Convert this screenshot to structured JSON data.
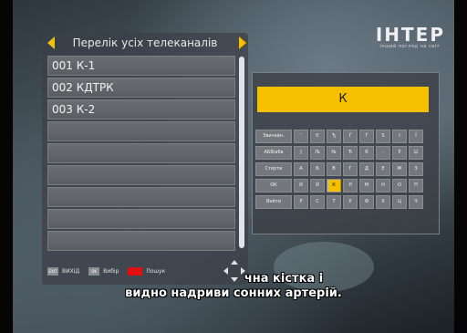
{
  "channel": {
    "logo": "ІНТЕР",
    "logo_tagline": "інший погляд на світ"
  },
  "panel": {
    "title": "Перелік усіх телеканалів",
    "items": [
      {
        "label": "001 К-1"
      },
      {
        "label": "002 КДТРК"
      },
      {
        "label": "003 К-2"
      },
      {
        "label": ""
      },
      {
        "label": ""
      },
      {
        "label": ""
      },
      {
        "label": ""
      },
      {
        "label": ""
      },
      {
        "label": ""
      }
    ]
  },
  "footer": {
    "exit_key": "EXIT",
    "exit_label": "ВИХІД",
    "ok_key": "OK",
    "ok_label": "Вибір",
    "search_label": "Пошук"
  },
  "search": {
    "input_value": "К",
    "keyboard_rows": [
      {
        "fn": "Звичайн.",
        "keys": [
          "'",
          "Є",
          "Ђ",
          "Ґ",
          "Ѓ",
          "S",
          "І",
          "Ї"
        ]
      },
      {
        "fn": "АБВ/абв",
        "keys": [
          "Ј",
          "Љ",
          "Њ",
          "Ћ",
          "Ќ",
          "-",
          "Ў",
          "Џ"
        ]
      },
      {
        "fn": "Стерти",
        "keys": [
          "А",
          "Б",
          "В",
          "Г",
          "Д",
          "Е",
          "Ж",
          "З"
        ]
      },
      {
        "fn": "ОК",
        "keys": [
          "И",
          "Й",
          "К",
          "Л",
          "М",
          "Н",
          "О",
          "П"
        ]
      },
      {
        "fn": "Вийти",
        "keys": [
          "Р",
          "С",
          "Т",
          "У",
          "Ф",
          "Х",
          "Ц",
          "Ч"
        ]
      }
    ],
    "selected_key": "К"
  },
  "subtitles": {
    "line1": "чна кістка і",
    "line2": "видно надриви сонних артерій."
  },
  "colors": {
    "accent": "#f5c000",
    "panel": "#3c4046",
    "row": "#64686d",
    "red_key": "#e01010"
  }
}
